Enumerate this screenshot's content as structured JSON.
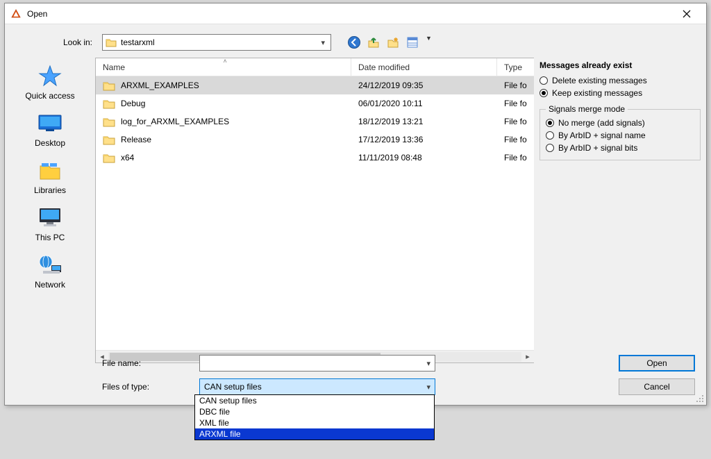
{
  "titlebar": {
    "title": "Open"
  },
  "lookin": {
    "label": "Look in:",
    "value": "testarxml"
  },
  "columns": {
    "name": "Name",
    "date": "Date modified",
    "type": "Type"
  },
  "files": [
    {
      "name": "ARXML_EXAMPLES",
      "date": "24/12/2019 09:35",
      "type": "File fo",
      "selected": true
    },
    {
      "name": "Debug",
      "date": "06/01/2020 10:11",
      "type": "File fo",
      "selected": false
    },
    {
      "name": "log_for_ARXML_EXAMPLES",
      "date": "18/12/2019 13:21",
      "type": "File fo",
      "selected": false
    },
    {
      "name": "Release",
      "date": "17/12/2019 13:36",
      "type": "File fo",
      "selected": false
    },
    {
      "name": "x64",
      "date": "11/11/2019 08:48",
      "type": "File fo",
      "selected": false
    }
  ],
  "places": {
    "quick_access": "Quick access",
    "desktop": "Desktop",
    "libraries": "Libraries",
    "this_pc": "This PC",
    "network": "Network"
  },
  "right": {
    "messages_title": "Messages already exist",
    "opt_delete": "Delete existing messages",
    "opt_keep": "Keep existing messages",
    "merge_title": "Signals merge mode",
    "merge_no": "No merge (add signals)",
    "merge_name": "By ArbID + signal name",
    "merge_bits": "By ArbID + signal bits"
  },
  "bottom": {
    "file_name_label": "File name:",
    "file_name_value": "",
    "file_type_label": "Files of type:",
    "file_type_value": "CAN setup files",
    "open_label": "Open",
    "cancel_label": "Cancel"
  },
  "dropdown_options": [
    "CAN setup files",
    "DBC file",
    "XML file",
    "ARXML file"
  ],
  "dropdown_highlight_index": 3
}
